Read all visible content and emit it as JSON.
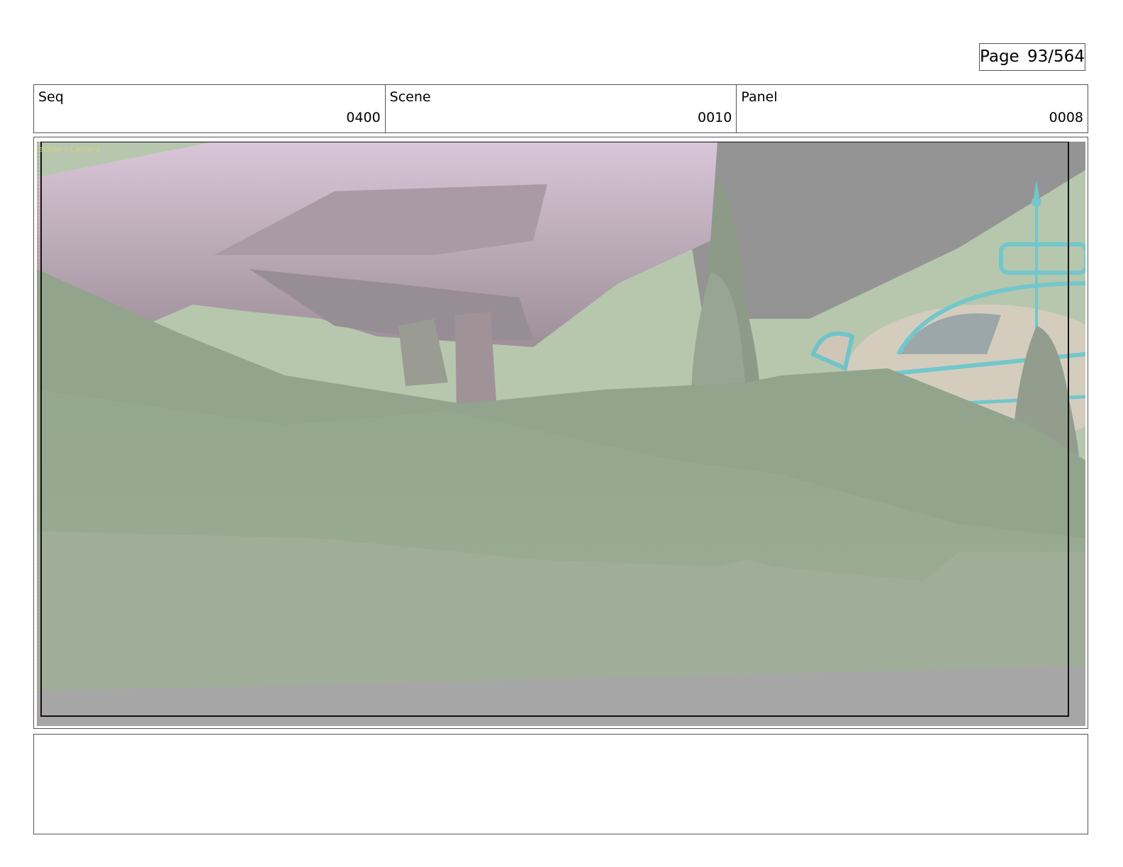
{
  "page": {
    "label": "Page",
    "current": "93/564"
  },
  "header": {
    "seq": {
      "label": "Seq",
      "value": "0400"
    },
    "scene": {
      "label": "Scene",
      "value": "0010"
    },
    "panel": {
      "label": "Panel",
      "value": "0008"
    }
  },
  "viewport": {
    "label": "ection | Camera"
  },
  "notes": {
    "text": ""
  }
}
